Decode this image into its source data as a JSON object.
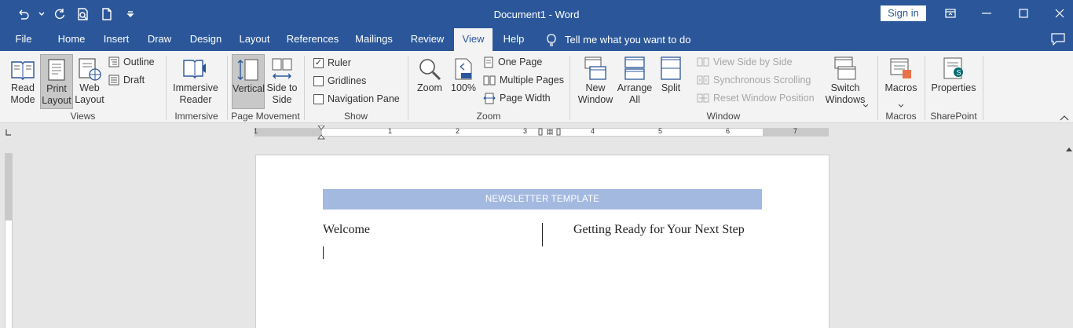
{
  "title_bar": {
    "document_title": "Document1  -  Word",
    "sign_in": "Sign in"
  },
  "tabs": [
    "File",
    "Home",
    "Insert",
    "Draw",
    "Design",
    "Layout",
    "References",
    "Mailings",
    "Review",
    "View",
    "Help"
  ],
  "active_tab": "View",
  "tell_me": "Tell me what you want to do",
  "ribbon": {
    "views": {
      "label": "Views",
      "read_mode": "Read Mode",
      "print_layout": "Print Layout",
      "web_layout": "Web Layout",
      "outline": "Outline",
      "draft": "Draft"
    },
    "immersive": {
      "label": "Immersive",
      "immersive_reader": "Immersive Reader"
    },
    "page_movement": {
      "label": "Page Movement",
      "vertical": "Vertical",
      "side_to_side": "Side to Side"
    },
    "show": {
      "label": "Show",
      "ruler": "Ruler",
      "ruler_checked": true,
      "gridlines": "Gridlines",
      "gridlines_checked": false,
      "navigation_pane": "Navigation Pane",
      "navigation_pane_checked": false
    },
    "zoom": {
      "label": "Zoom",
      "zoom": "Zoom",
      "hundred": "100%",
      "one_page": "One Page",
      "multiple_pages": "Multiple Pages",
      "page_width": "Page Width"
    },
    "window": {
      "label": "Window",
      "new_window": "New Window",
      "arrange_all": "Arrange All",
      "split": "Split",
      "view_side_by_side": "View Side by Side",
      "synchronous_scrolling": "Synchronous Scrolling",
      "reset_window_position": "Reset Window Position",
      "switch_windows": "Switch Windows"
    },
    "macros": {
      "label": "Macros",
      "macros": "Macros"
    },
    "sharepoint": {
      "label": "SharePoint",
      "properties": "Properties"
    }
  },
  "ruler": {
    "numbers": [
      "1",
      "1",
      "2",
      "3",
      "4",
      "5",
      "6",
      "7"
    ]
  },
  "document": {
    "banner": "NEWSLETTER TEMPLATE",
    "left_heading": "Welcome",
    "right_heading": "Getting Ready for Your Next Step"
  },
  "colors": {
    "title_bar": "#2b579a",
    "ribbon": "#f3f3f3",
    "banner": "#a4b9df"
  }
}
